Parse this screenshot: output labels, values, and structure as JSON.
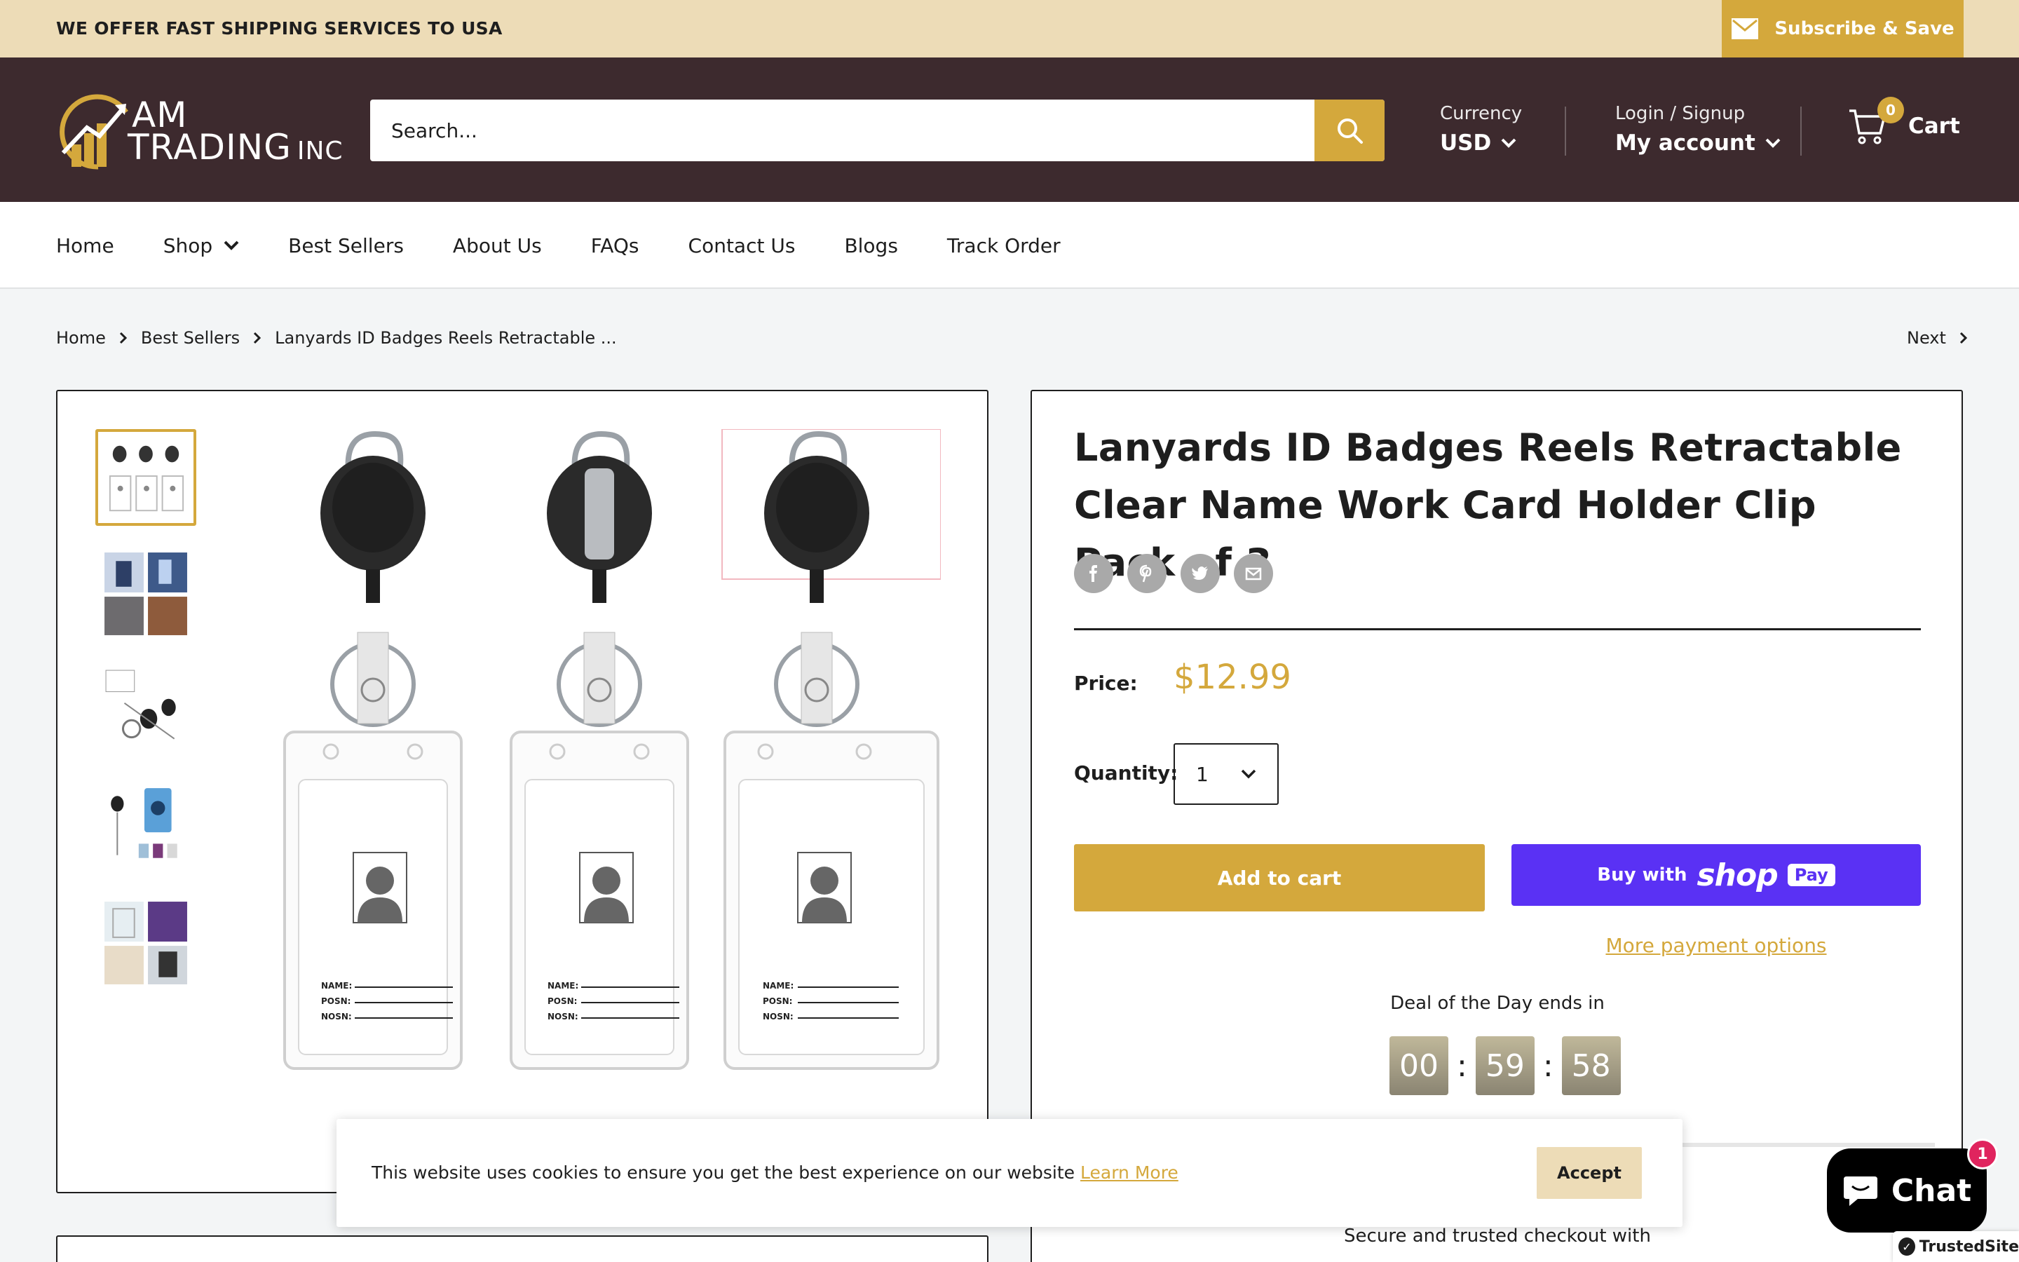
{
  "announcement": {
    "text": "WE OFFER FAST SHIPPING SERVICES TO USA",
    "subscribe_label": "Subscribe & Save"
  },
  "header": {
    "logo": {
      "line1": "AM",
      "line2": "TRADING",
      "line3": "INC"
    },
    "search_placeholder": "Search...",
    "currency_label": "Currency",
    "currency_value": "USD",
    "account_label": "Login / Signup",
    "account_value": "My account",
    "cart_count": "0",
    "cart_label": "Cart"
  },
  "nav": {
    "items": [
      "Home",
      "Shop",
      "Best Sellers",
      "About Us",
      "FAQs",
      "Contact Us",
      "Blogs",
      "Track Order"
    ]
  },
  "breadcrumb": {
    "items": [
      "Home",
      "Best Sellers",
      "Lanyards ID Badges Reels Retractable ..."
    ],
    "next_label": "Next"
  },
  "gallery": {
    "card_fields": [
      "NAME:",
      "POSN:",
      "NOSN:"
    ]
  },
  "product": {
    "title": "Lanyards ID Badges Reels Retractable Clear Name Work Card Holder Clip Pack of 3",
    "price_label": "Price:",
    "price": "$12.99",
    "quantity_label": "Quantity:",
    "quantity": "1",
    "add_to_cart": "Add to cart",
    "buy_with": "Buy with",
    "shop_word": "shop",
    "pay_word": "Pay",
    "more_payment": "More payment options",
    "deal_label": "Deal of the Day ends in",
    "timer": {
      "hours": "00",
      "minutes": "59",
      "seconds": "58"
    },
    "secure_text": "Secure and trusted checkout with"
  },
  "cookie": {
    "text": "This website uses cookies to ensure you get the best experience on our website",
    "link": "Learn More",
    "accept": "Accept"
  },
  "chat": {
    "label": "Chat",
    "badge": "1"
  },
  "trusted": {
    "label": "TrustedSite"
  },
  "colors": {
    "accent": "#d4a83c",
    "header_bg": "#3d2a2e",
    "announce_bg": "#eddcb7",
    "shop_pay": "#5a31f4"
  }
}
